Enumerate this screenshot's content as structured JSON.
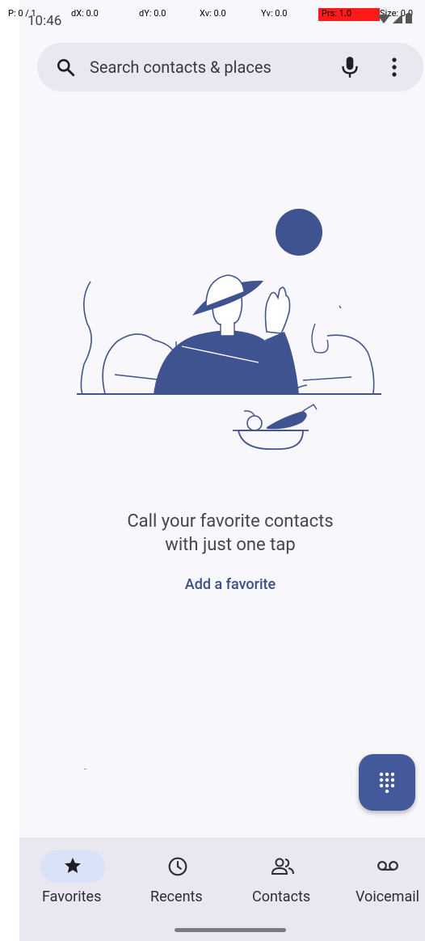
{
  "status_bar": {
    "time": "10:46",
    "debug": {
      "p": "P: 0 / 1",
      "dx": "dX: 0.0",
      "dy": "dY: 0.0",
      "xv": "Xv: 0.0",
      "yv": "Yv: 0.0",
      "prs": "Prs: 1.0",
      "size": "Size: 0.0"
    }
  },
  "search": {
    "placeholder": "Search contacts & places",
    "icons": [
      "search-icon",
      "mic-icon",
      "more-vert-icon"
    ]
  },
  "empty_state": {
    "headline_line1": "Call your favorite contacts",
    "headline_line2": "with just one tap",
    "action": "Add a favorite"
  },
  "fab": {
    "icon": "dialpad-icon"
  },
  "bottom_nav": {
    "items": [
      {
        "label": "Favorites",
        "icon": "star-icon",
        "selected": true
      },
      {
        "label": "Recents",
        "icon": "clock-icon",
        "selected": false
      },
      {
        "label": "Contacts",
        "icon": "people-icon",
        "selected": false
      },
      {
        "label": "Voicemail",
        "icon": "voicemail-icon",
        "selected": false
      }
    ]
  },
  "colors": {
    "accent": "#44599c",
    "illustration": "#3f5391",
    "background": "#f8f7fb",
    "nav_background": "#e9e8f0",
    "selected_pill": "#dae2f9"
  }
}
